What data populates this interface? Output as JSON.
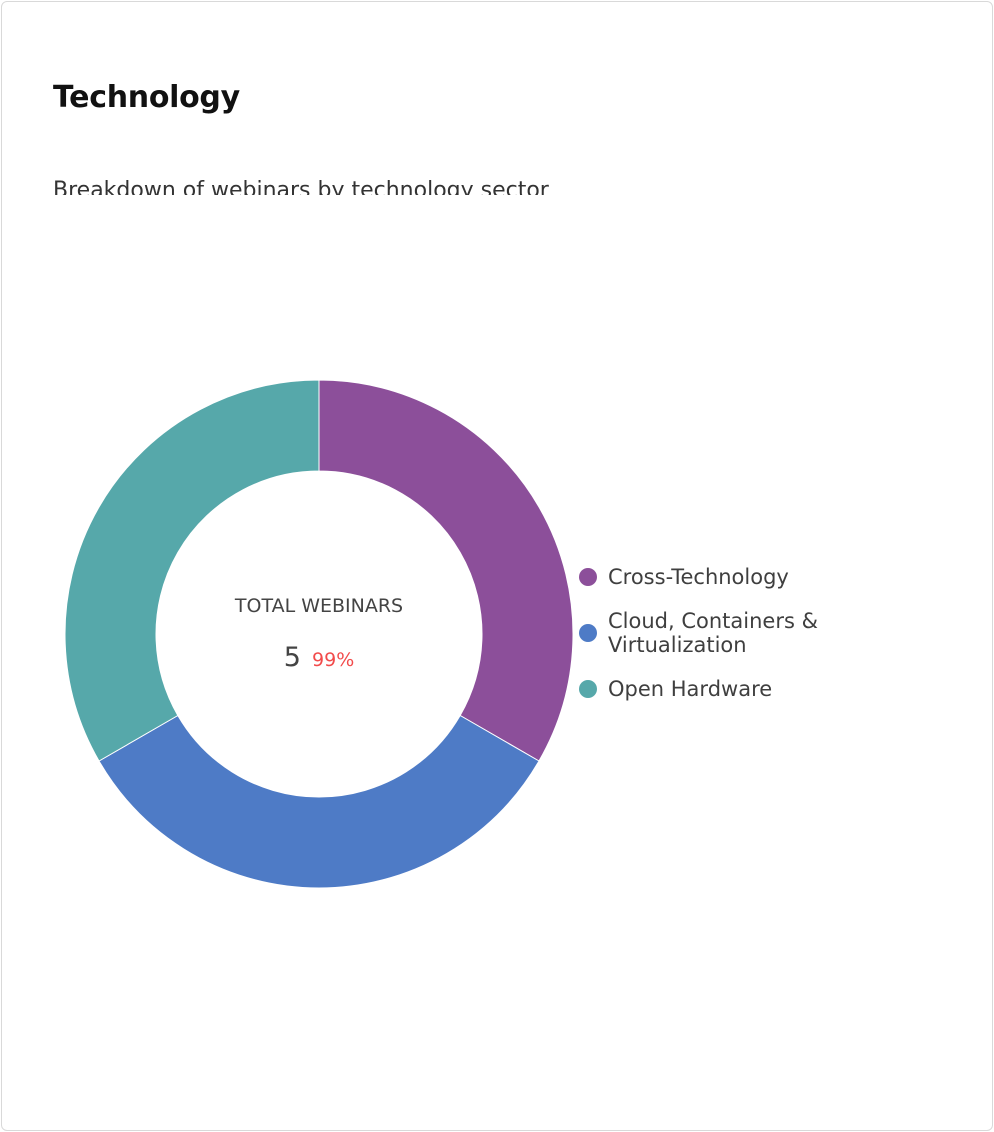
{
  "card": {
    "title": "Technology",
    "subtitle": "Breakdown of webinars by technology sector"
  },
  "chart_data": {
    "type": "pie",
    "variant": "donut",
    "center_label": "TOTAL WEBINARS",
    "center_value": "5",
    "center_change": "99%",
    "categories": [
      "Cross-Technology",
      "Cloud, Containers & Virtualization",
      "Open Hardware"
    ],
    "legend_lines": [
      [
        "Cross-Technology"
      ],
      [
        "Cloud, Containers &",
        "Virtualization"
      ],
      [
        "Open Hardware"
      ]
    ],
    "values": [
      33.3,
      33.3,
      33.3
    ],
    "colors": [
      "#8c4f9a",
      "#4e7bc6",
      "#56a8aa"
    ],
    "legend_position": "right"
  }
}
